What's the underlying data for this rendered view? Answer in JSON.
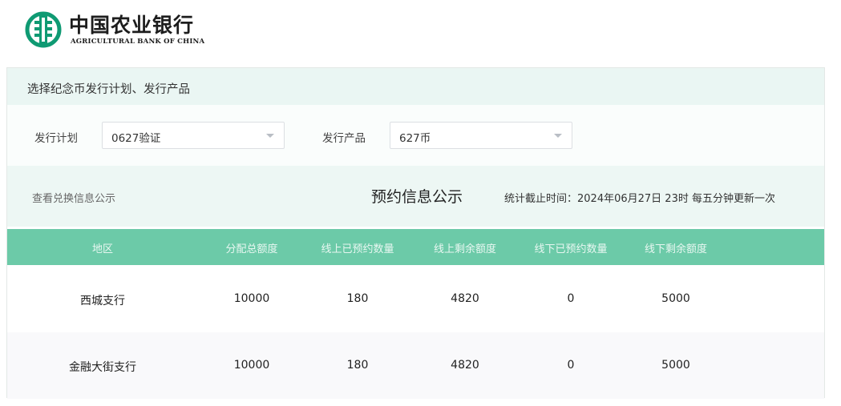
{
  "logo": {
    "cn": "中国农业银行",
    "en": "AGRICULTURAL BANK OF CHINA",
    "color": "#0f9a73"
  },
  "panel": {
    "title": "选择纪念币发行计划、发行产品"
  },
  "filters": {
    "plan_label": "发行计划",
    "plan_value": "0627验证",
    "product_label": "发行产品",
    "product_value": "627币"
  },
  "info": {
    "link": "查看兑换信息公示",
    "title": "预约信息公示",
    "stat": "统计截止时间：2024年06月27日 23时 每五分钟更新一次"
  },
  "table": {
    "headers": [
      "地区",
      "分配总额度",
      "线上已预约数量",
      "线上剩余额度",
      "线下已预约数量",
      "线下剩余额度"
    ],
    "rows": [
      [
        "西城支行",
        "10000",
        "180",
        "4820",
        "0",
        "5000"
      ],
      [
        "金融大街支行",
        "10000",
        "180",
        "4820",
        "0",
        "5000"
      ]
    ]
  },
  "colors": {
    "header_bg": "#6ccaa8",
    "panel_head_bg": "#eaf6f3",
    "info_bg": "#edf7f4"
  }
}
